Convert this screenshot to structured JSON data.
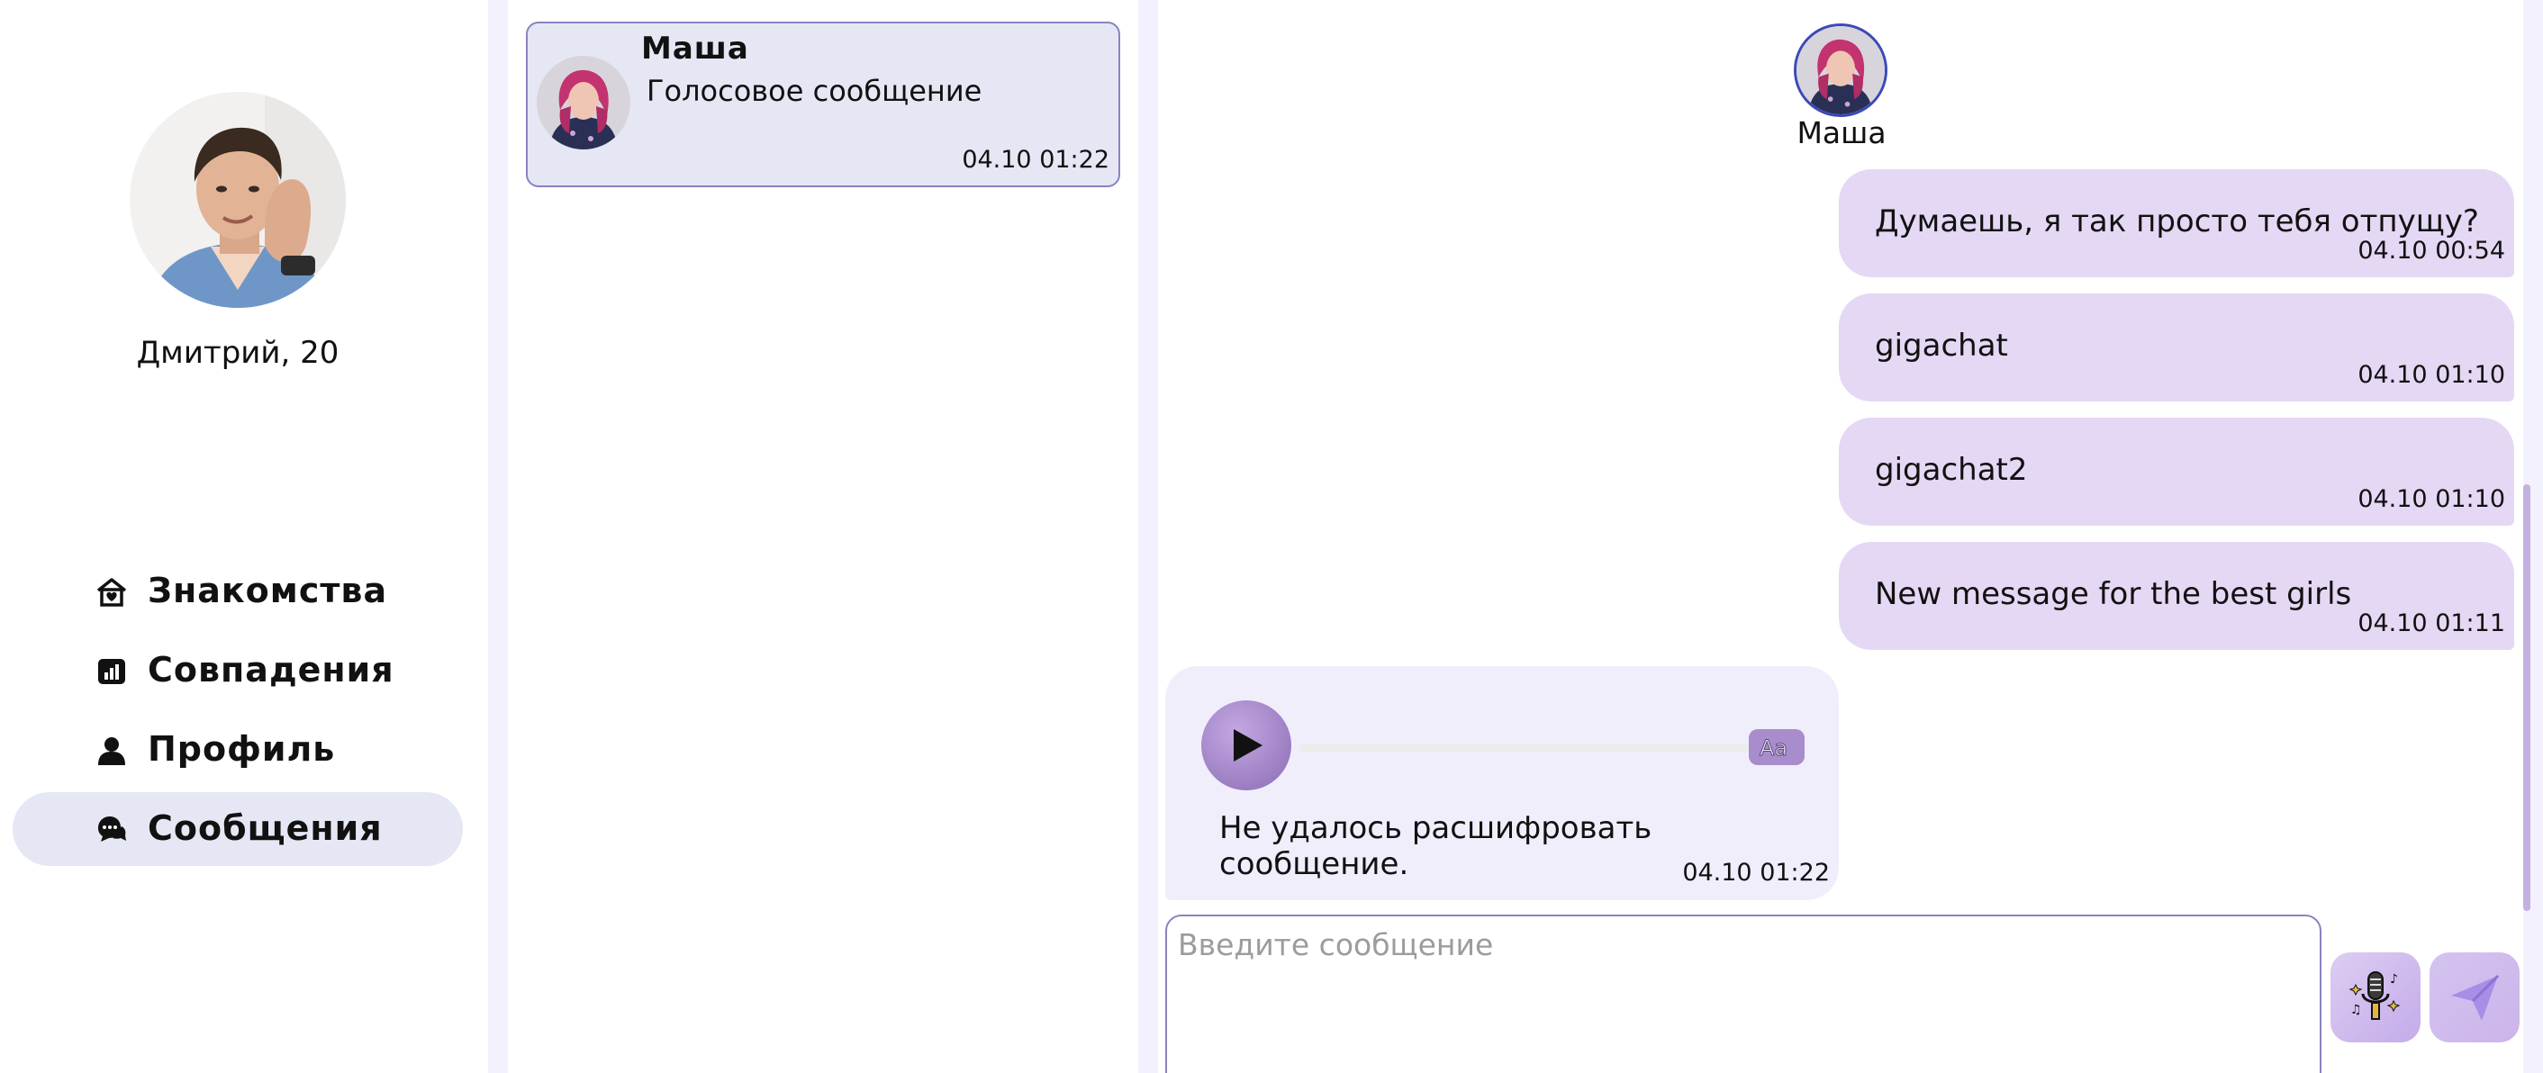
{
  "profile": {
    "name_age": "Дмитрий, 20",
    "avatar": "man-portrait-avatar"
  },
  "nav": {
    "items": [
      {
        "label": "Знакомства",
        "icon": "home-heart-icon",
        "active": false
      },
      {
        "label": "Совпадения",
        "icon": "chart-icon",
        "active": false
      },
      {
        "label": "Профиль",
        "icon": "user-icon",
        "active": false
      },
      {
        "label": "Сообщения",
        "icon": "chat-bubbles-icon",
        "active": true
      }
    ]
  },
  "conversations": [
    {
      "name": "Маша",
      "last_message": "Голосовое сообщение",
      "time": "04.10 01:22",
      "avatar": "woman-pink-hair-avatar"
    }
  ],
  "chat": {
    "partner_name": "Маша",
    "messages": [
      {
        "direction": "out",
        "text": "Думаешь, я так просто тебя отпущу?",
        "time": "04.10 00:54"
      },
      {
        "direction": "out",
        "text": "gigachat",
        "time": "04.10 01:10"
      },
      {
        "direction": "out",
        "text": "gigachat2",
        "time": "04.10 01:10"
      },
      {
        "direction": "out",
        "text": "New message for the best girls",
        "time": "04.10 01:11"
      },
      {
        "direction": "in",
        "type": "voice",
        "text": "Не удалось расшифровать сообщение.",
        "time": "04.10 01:22",
        "progress": 0
      }
    ],
    "composer": {
      "placeholder": "Введите сообщение",
      "value": ""
    },
    "buttons": {
      "voice": "microphone-icon",
      "send": "paper-plane-icon",
      "play": "play-icon",
      "transcribe": "text-aa-icon"
    }
  },
  "colors": {
    "accent": "#8b82c0",
    "bubble_out": "#e5d8f4",
    "bubble_in": "#f1eefc",
    "nav_active": "#e6e7f4",
    "avatar_ring": "#3b49b8"
  }
}
